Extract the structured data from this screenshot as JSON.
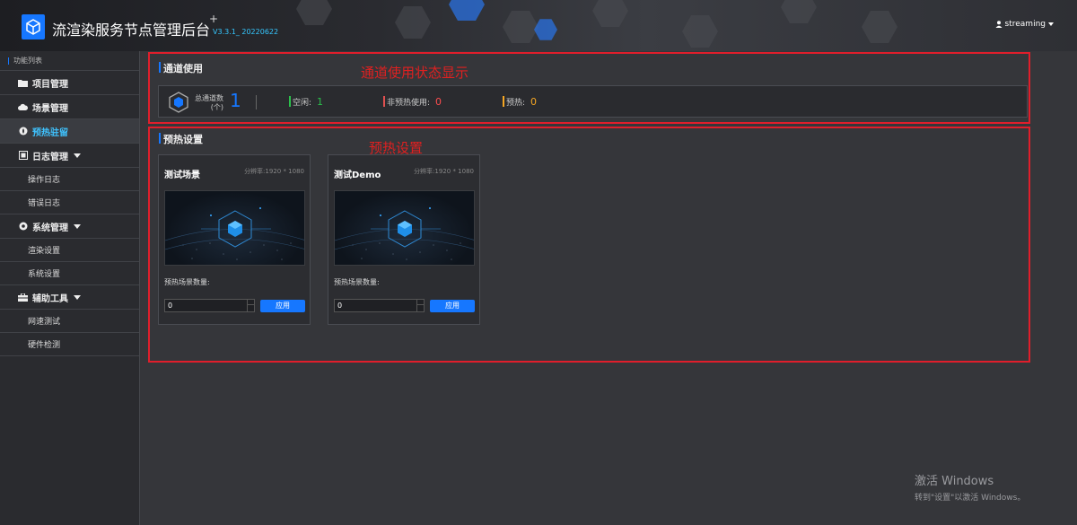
{
  "header": {
    "title": "流渲染服务节点管理后台",
    "version": "V3.3.1_ 20220622",
    "plus": "+",
    "user": "streaming"
  },
  "sidebar": {
    "heading": "功能列表",
    "items": [
      {
        "label": "项目管理",
        "icon": "folder-icon"
      },
      {
        "label": "场景管理",
        "icon": "cloud-icon"
      },
      {
        "label": "预热驻留",
        "icon": "flame-icon",
        "active": true
      },
      {
        "label": "日志管理",
        "icon": "log-icon",
        "expandable": true
      },
      {
        "label": "操作日志",
        "sub": true
      },
      {
        "label": "错误日志",
        "sub": true
      },
      {
        "label": "系统管理",
        "icon": "gear-icon",
        "expandable": true
      },
      {
        "label": "渲染设置",
        "sub": true
      },
      {
        "label": "系统设置",
        "sub": true
      },
      {
        "label": "辅助工具",
        "icon": "toolbox-icon",
        "expandable": true
      },
      {
        "label": "网速测试",
        "sub": true
      },
      {
        "label": "硬件检测",
        "sub": true
      }
    ]
  },
  "channel": {
    "title": "通道使用",
    "annotation": "通道使用状态显示",
    "total_label_1": "总通道数",
    "total_label_2": "(个)",
    "total_value": "1",
    "idle_label": "空闲:",
    "idle_value": "1",
    "busy_label": "非预热使用:",
    "busy_value": "0",
    "preheat_label": "预热:",
    "preheat_value": "0"
  },
  "preheat": {
    "title": "预热设置",
    "annotation": "预热设置",
    "cards": [
      {
        "title": "测试场景",
        "resolution": "分辨率:1920 * 1080",
        "count_label": "预热场景数量:",
        "count_value": "0",
        "apply_label": "应用"
      },
      {
        "title": "测试Demo",
        "resolution": "分辨率:1920 * 1080",
        "count_label": "预热场景数量:",
        "count_value": "0",
        "apply_label": "应用"
      }
    ]
  },
  "watermark": {
    "line1": "激活 Windows",
    "line2": "转到\"设置\"以激活 Windows。"
  },
  "colors": {
    "accent": "#1677ff",
    "annotation_red": "#e01e2b",
    "idle_green": "#2bbf4b",
    "busy_red": "#ff4d4f",
    "preheat_orange": "#f5a623"
  }
}
